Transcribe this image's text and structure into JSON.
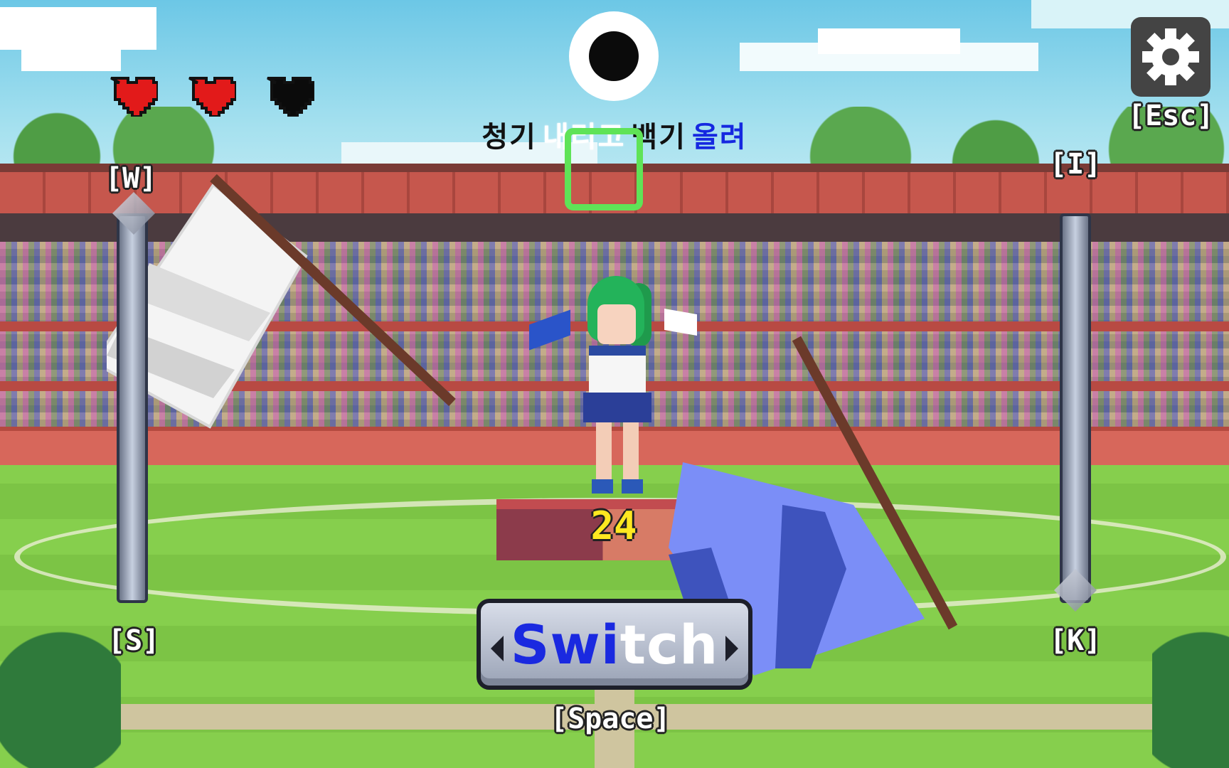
{
  "hud": {
    "lives": [
      {
        "state": "full",
        "color": "#e21a1a"
      },
      {
        "state": "full",
        "color": "#e21a1a"
      },
      {
        "state": "empty",
        "color": "#0b0b0b"
      }
    ],
    "cue_color": "#0b0b0b",
    "command": {
      "words": [
        {
          "text": "청기",
          "color": "black"
        },
        {
          "text": "내리고",
          "color": "white"
        },
        {
          "text": "백기",
          "color": "black"
        },
        {
          "text": "올려",
          "color": "blue"
        }
      ]
    },
    "target_box_color": "#5fe357",
    "score": "24"
  },
  "settings": {
    "icon": "gear-icon",
    "key_label": "[Esc]"
  },
  "controls": {
    "left_up_key": "[W]",
    "left_down_key": "[S]",
    "right_up_key": "[I]",
    "right_down_key": "[K]",
    "switch": {
      "label_part1": "Swi",
      "label_part2": "tch",
      "key_label": "[Space]"
    }
  },
  "colors": {
    "white_flag": "#ffffff",
    "blue_flag": "#6f86f2",
    "score": "#ffe820",
    "switch_text_blue": "#1a29e0"
  }
}
